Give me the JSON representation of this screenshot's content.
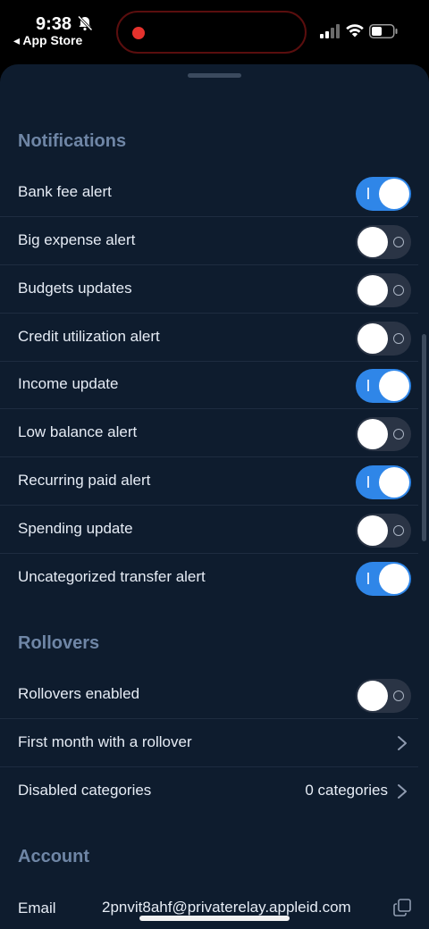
{
  "status_bar": {
    "time": "9:38",
    "back_app": "◂ App Store"
  },
  "sections": {
    "notifications": "Notifications",
    "rollovers": "Rollovers",
    "account": "Account"
  },
  "notifications": [
    {
      "label": "Bank fee alert",
      "on": true
    },
    {
      "label": "Big expense alert",
      "on": false
    },
    {
      "label": "Budgets updates",
      "on": false
    },
    {
      "label": "Credit utilization alert",
      "on": false
    },
    {
      "label": "Income update",
      "on": true
    },
    {
      "label": "Low balance alert",
      "on": false
    },
    {
      "label": "Recurring paid alert",
      "on": true
    },
    {
      "label": "Spending update",
      "on": false
    },
    {
      "label": "Uncategorized transfer alert",
      "on": true
    }
  ],
  "rollovers": {
    "enabled_label": "Rollovers enabled",
    "enabled_on": false,
    "first_month_label": "First month with a rollover",
    "disabled_categories_label": "Disabled categories",
    "disabled_categories_value": "0 categories"
  },
  "account": {
    "email_label": "Email",
    "email_value": "2pnvit8ahf@privaterelay.appleid.com"
  },
  "colors": {
    "sheet_bg": "#0e1c2e",
    "toggle_on": "#2f86e8",
    "toggle_off": "#2a3445",
    "section_title": "#6f86a6"
  }
}
